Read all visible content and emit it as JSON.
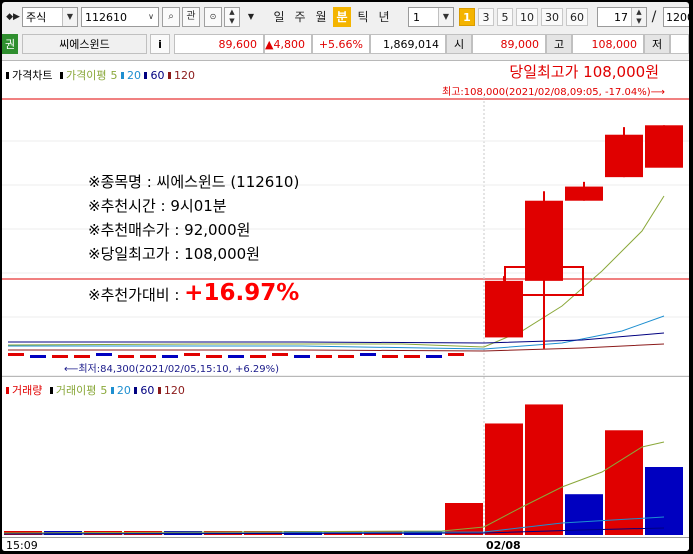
{
  "toolbar": {
    "market_type": "주식",
    "stock_code": "112610",
    "btn_relation": "관",
    "period_buttons": [
      {
        "label": "일",
        "selected": false
      },
      {
        "label": "주",
        "selected": false
      },
      {
        "label": "월",
        "selected": false
      },
      {
        "label": "분",
        "selected": true
      },
      {
        "label": "틱",
        "selected": false
      },
      {
        "label": "년",
        "selected": false
      }
    ],
    "interval_value": "1",
    "minute_buttons": [
      {
        "label": "1",
        "selected": true
      },
      {
        "label": "3",
        "selected": false
      },
      {
        "label": "5",
        "selected": false
      },
      {
        "label": "10",
        "selected": false
      },
      {
        "label": "30",
        "selected": false
      },
      {
        "label": "60",
        "selected": false
      }
    ],
    "count_value": "17",
    "separator": "/",
    "total_value": "1200"
  },
  "quote": {
    "tag": "권",
    "stock_name": "씨에스윈드",
    "info_button": "i",
    "price": "89,600",
    "change": "▲4,800",
    "change_pct": "+5.66%",
    "volume": "1,869,014",
    "open_label": "시",
    "open_value": "89,000",
    "high_label": "고",
    "high_value": "108,000",
    "low_label": "저"
  },
  "price_chart": {
    "legend": {
      "main": "가격차트",
      "ma_label": "가격이평",
      "ma_periods": [
        "5",
        "20",
        "60",
        "120"
      ]
    },
    "day_high_title": "당일최고가 108,000원",
    "high_annotation": "최고:108,000(2021/02/08,09:05, -17.04%)⟶",
    "low_annotation": "⟵최저:84,300(2021/02/05,15:10, +6.29%)",
    "info_lines": [
      "※종목명 : 씨에스윈드 (112610)",
      "※추천시간 : 9시01분",
      "※추천매수가 : 92,000원",
      "※당일최고가 : 108,000원"
    ],
    "ratio_label": "※추천가대비 : ",
    "ratio_value": "+16.97%"
  },
  "volume_chart": {
    "legend": {
      "main": "거래량",
      "ma_label": "거래이평",
      "ma_periods": [
        "5",
        "20",
        "60",
        "120"
      ]
    }
  },
  "x_axis": {
    "left_label": "15:09",
    "date_label": "02/08"
  },
  "colors": {
    "up": "#e00000",
    "down": "#0000c0",
    "ma5": "#8aa83a",
    "ma20": "#1e8fd0",
    "ma60": "#000080",
    "ma120": "#8b1a1a",
    "highlight": "#f4b400"
  },
  "chart_data": {
    "type": "candlestick",
    "price_candles": [
      {
        "open": 85500,
        "close": 91500,
        "high": 92000,
        "low": 91500,
        "dir": "up"
      },
      {
        "open": 91500,
        "close": 100000,
        "high": 101000,
        "low": 84300,
        "dir": "up"
      },
      {
        "open": 100000,
        "close": 101500,
        "high": 102000,
        "low": 100000,
        "dir": "up"
      },
      {
        "open": 102500,
        "close": 107000,
        "high": 107800,
        "low": 102500,
        "dir": "up"
      },
      {
        "open": 103500,
        "close": 108000,
        "high": 108000,
        "low": 104000,
        "dir": "up"
      }
    ],
    "volume_bars": [
      {
        "dir": "up",
        "v": 0.12
      },
      {
        "dir": "up",
        "v": 0.82
      },
      {
        "dir": "up",
        "v": 0.96
      },
      {
        "dir": "down",
        "v": 0.3
      },
      {
        "dir": "up",
        "v": 0.77
      },
      {
        "dir": "down",
        "v": 0.5
      }
    ]
  }
}
